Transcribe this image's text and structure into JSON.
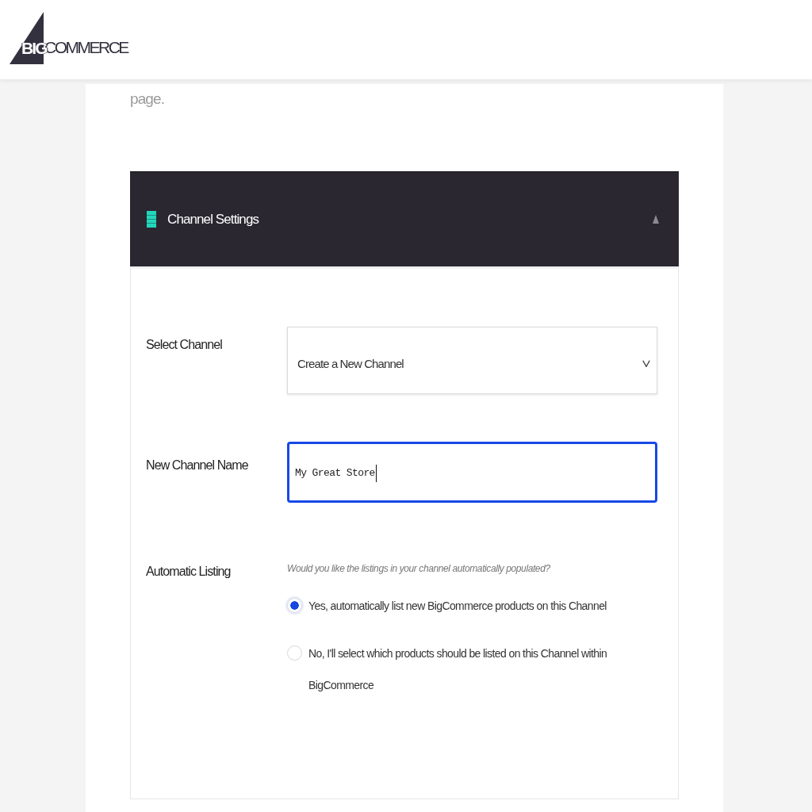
{
  "header": {
    "logo": {
      "mark_text": "BIG",
      "wordmark": "COMMERCE"
    }
  },
  "intro_text": "page.",
  "panel": {
    "title": "Channel Settings",
    "expanded": true,
    "fields": [
      {
        "kind": "select",
        "label": "Select Channel",
        "value": "Create a New Channel"
      },
      {
        "kind": "text",
        "label": "New Channel Name",
        "value": "My Great Store",
        "focused": true
      },
      {
        "kind": "radio_group",
        "label": "Automatic Listing",
        "hint": "Would you like the listings in your channel automatically populated?",
        "options": [
          {
            "label": "Yes, automatically list new BigCommerce products on this Channel",
            "selected": true
          },
          {
            "label": "No, I'll select which products should be listed on this Channel within BigCommerce",
            "selected": false
          }
        ]
      }
    ]
  }
}
